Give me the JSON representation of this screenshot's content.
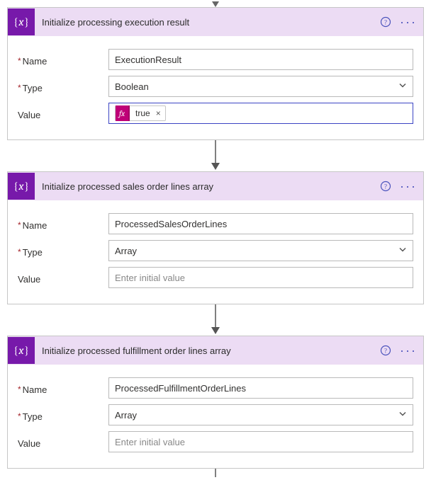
{
  "cards": [
    {
      "title": "Initialize processing execution result",
      "name_label": "Name",
      "name_value": "ExecutionResult",
      "type_label": "Type",
      "type_value": "Boolean",
      "value_label": "Value",
      "value_mode": "token",
      "token_fx": "fx",
      "token_text": "true",
      "value_placeholder": ""
    },
    {
      "title": "Initialize processed sales order lines array",
      "name_label": "Name",
      "name_value": "ProcessedSalesOrderLines",
      "type_label": "Type",
      "type_value": "Array",
      "value_label": "Value",
      "value_mode": "placeholder",
      "value_placeholder": "Enter initial value"
    },
    {
      "title": "Initialize processed fulfillment order lines array",
      "name_label": "Name",
      "name_value": "ProcessedFulfillmentOrderLines",
      "type_label": "Type",
      "type_value": "Array",
      "value_label": "Value",
      "value_mode": "placeholder",
      "value_placeholder": "Enter initial value"
    }
  ]
}
